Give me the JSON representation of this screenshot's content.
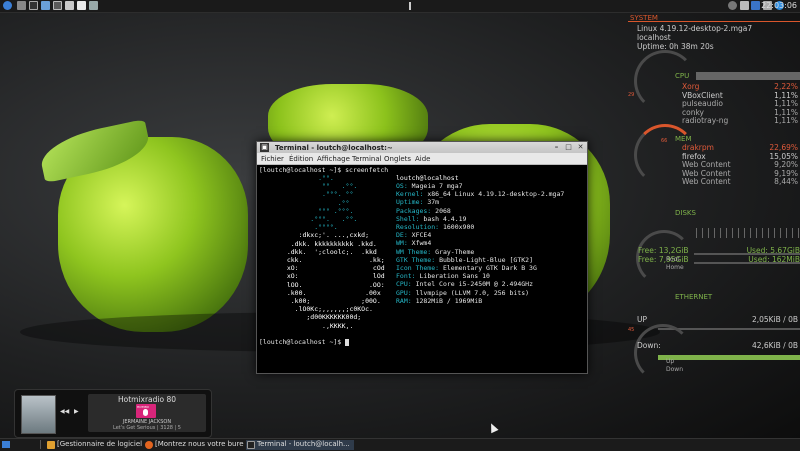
{
  "top_panel": {
    "clock": "22:03:06",
    "launchers": [
      "app-menu-icon",
      "files-icon",
      "terminal-icon",
      "settings-icon",
      "monitor-icon",
      "image-icon",
      "document-icon",
      "tools-icon"
    ],
    "tray": [
      "power-icon",
      "chat-icon",
      "bluetooth-icon",
      "volume-icon",
      "network-icon"
    ]
  },
  "terminal": {
    "title": "Terminal - loutch@localhost:~",
    "menu": [
      "Fichier",
      "Édition",
      "Affichage",
      "Terminal",
      "Onglets",
      "Aide"
    ],
    "prompt": "[loutch@localhost ~]$",
    "command": "screenfetch",
    "logo": [
      "          .°°.",
      "           °°   .°°.",
      "           .°°°. °°",
      "               .°°",
      "          °°° .°°°.",
      "        .°°°.   .°°.",
      "         .°°°°.",
      "     :dkxc;'. ...,cxkd;",
      "   .dkk. kkkkkkkkkk .kkd.",
      "  .dkk.  ';cloolc;.  .kkd",
      "  ckk.                 .kk;",
      "  xO:                   cOd",
      "  xO:                   lOd",
      "  lOO.                 .OO:",
      "  .k00.               .00x",
      "   .k00;             ;00O.",
      "    .lO0Kc;,,,,,,;c0KOc.",
      "       ;d00KKKKKK00d;",
      "           .,KKKK,."
    ],
    "user_host": "loutch@localhost",
    "info": [
      {
        "key": "OS:",
        "value": "Mageia 7 mga7"
      },
      {
        "key": "Kernel:",
        "value": "x86_64 Linux 4.19.12-desktop-2.mga7"
      },
      {
        "key": "Uptime:",
        "value": "37m"
      },
      {
        "key": "Packages:",
        "value": "2068"
      },
      {
        "key": "Shell:",
        "value": "bash 4.4.19"
      },
      {
        "key": "Resolution:",
        "value": "1600x900"
      },
      {
        "key": "DE:",
        "value": "XFCE4"
      },
      {
        "key": "WM:",
        "value": "Xfwm4"
      },
      {
        "key": "WM Theme:",
        "value": "Gray-Theme"
      },
      {
        "key": "GTK Theme:",
        "value": "Bubble-Light-Blue [GTK2]"
      },
      {
        "key": "Icon Theme:",
        "value": "Elementary GTK Dark B 3G"
      },
      {
        "key": "Font:",
        "value": "Liberation Sans 10"
      },
      {
        "key": "CPU:",
        "value": "Intel Core i5-2450M @ 2.494GHz"
      },
      {
        "key": "GPU:",
        "value": "llvmpipe (LLVM 7.0, 256 bits)"
      },
      {
        "key": "RAM:",
        "value": "1282MiB / 1969MiB"
      }
    ]
  },
  "conky": {
    "system": {
      "title": "SYSTEM",
      "kernel": "Linux 4.19.12-desktop-2.mga7",
      "host": "localhost",
      "uptime": "Uptime: 0h 38m 20s"
    },
    "cpu": {
      "title": "CPU",
      "gauge_label": "29",
      "processes": [
        {
          "name": "Xorg",
          "value": "2,22%",
          "highlight": true
        },
        {
          "name": "VBoxClient",
          "value": "1,11%",
          "highlight": false
        },
        {
          "name": "pulseaudio",
          "value": "1,11%",
          "highlight": false
        },
        {
          "name": "conky",
          "value": "1,11%",
          "highlight": false
        },
        {
          "name": "radiotray-ng",
          "value": "1,11%",
          "highlight": false
        }
      ]
    },
    "mem": {
      "title": "MEM",
      "gauge_label": "66",
      "processes": [
        {
          "name": "drakrpm",
          "value": "22,69%",
          "highlight": true
        },
        {
          "name": "firefox",
          "value": "15,05%",
          "highlight": false
        },
        {
          "name": "Web Content",
          "value": "9,20%",
          "highlight": false
        },
        {
          "name": "Web Content",
          "value": "9,19%",
          "highlight": false
        },
        {
          "name": "Web Content",
          "value": "8,44%",
          "highlight": false
        }
      ]
    },
    "disks": {
      "title": "DISKS",
      "root_free": "Free: 13,2GiB",
      "root_used": "Used: 5,67GiB",
      "home_free": "Free: 7,95GiB",
      "home_used": "Used: 162MiB",
      "root_label": "Root",
      "home_label": "Home"
    },
    "ethernet": {
      "title": "ETHERNET",
      "up_label": "UP",
      "up_value": "2,05KiB / 0B",
      "down_label": "Down:",
      "down_value": "42,6KiB / 0B",
      "gauge_up": "Up",
      "gauge_down": "Down",
      "gauge_value": "45"
    },
    "colors": {
      "accent_red": "#d9562c",
      "accent_green": "#7fb34a"
    }
  },
  "music": {
    "station": "Hotmixradio 80",
    "badge": "HOTMIX",
    "artist": "JERMAINE JACKSON",
    "track": "Let's Get Serious | 3128 | 5"
  },
  "taskbar": {
    "tasks": [
      {
        "label": "[Gestionnaire de logiciels]",
        "active": false
      },
      {
        "label": "[Montrez nous votre bure...",
        "active": false
      },
      {
        "label": "Terminal - loutch@localh...",
        "active": true
      }
    ]
  }
}
